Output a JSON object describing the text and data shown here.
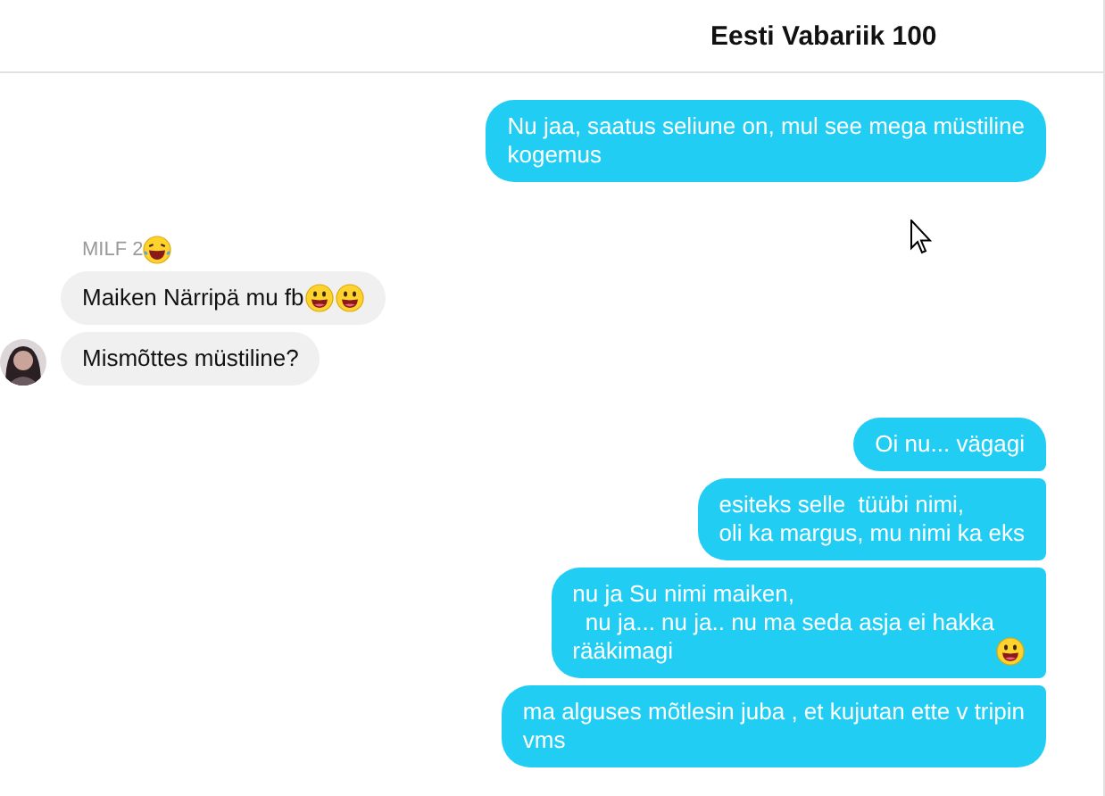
{
  "header": {
    "title": "Eesti Vabariik 100"
  },
  "groups": [
    {
      "kind": "outgoing",
      "messages": [
        {
          "text": "Nu jaa, saatus seliune on, mul see mega müstiline\nkogemus"
        }
      ]
    },
    {
      "kind": "incoming",
      "sender": {
        "name": "MILF 2",
        "emojis": [
          {
            "kind": "laughing"
          }
        ]
      },
      "messages": [
        {
          "text": "Maiken Närripä mu fb",
          "emojis": [
            {
              "kind": "grinning"
            },
            {
              "kind": "grinning"
            }
          ]
        },
        {
          "text": "Mismõttes müstiline?"
        }
      ]
    },
    {
      "kind": "outgoing",
      "messages": [
        {
          "text": "Oi nu... vägagi"
        },
        {
          "text": "esiteks selle  tüübi nimi,\noli ka margus, mu nimi ka eks"
        },
        {
          "text": "nu ja Su nimi maiken,\n  nu ja... nu ja.. nu ma seda asja ei hakka\nrääkimagi ",
          "emojis": [
            {
              "kind": "grinning"
            }
          ]
        },
        {
          "text": "ma alguses mõtlesin juba , et kujutan ette v tripin\nvms"
        }
      ]
    }
  ]
}
